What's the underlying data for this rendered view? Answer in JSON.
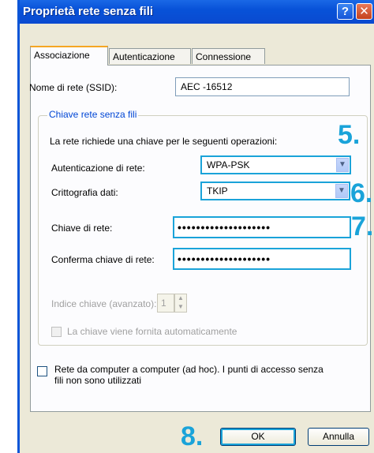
{
  "window": {
    "title": "Proprietà rete senza fili",
    "help_glyph": "?",
    "close_glyph": "✕"
  },
  "tabs": [
    {
      "label": "Associazione",
      "active": true
    },
    {
      "label": "Autenticazione",
      "active": false
    },
    {
      "label": "Connessione",
      "active": false
    }
  ],
  "ssid": {
    "label": "Nome di rete (SSID):",
    "value": "AEC -16512"
  },
  "wireless_key": {
    "legend": "Chiave rete senza fili",
    "intro": "La rete richiede una chiave per le seguenti operazioni:",
    "auth": {
      "label": "Autenticazione di rete:",
      "value": "WPA-PSK"
    },
    "encryption": {
      "label": "Crittografia dati:",
      "value": "TKIP"
    },
    "key": {
      "label": "Chiave di rete:",
      "value": "••••••••••••••••••••"
    },
    "confirm": {
      "label": "Conferma chiave di rete:",
      "value": "••••••••••••••••••••"
    },
    "index": {
      "label": "Indice chiave (avanzato):",
      "value": "1"
    },
    "auto": {
      "label": "La chiave viene fornita automaticamente"
    }
  },
  "adhoc": {
    "label": "Rete da computer a computer (ad hoc). I punti di accesso senza fili non sono utilizzati"
  },
  "buttons": {
    "ok": "OK",
    "cancel": "Annulla"
  },
  "steps": {
    "s5": "5.",
    "s6": "6.",
    "s7": "7.",
    "s8": "8."
  },
  "colors": {
    "accent": "#1aa3d9",
    "title_bar": "#0a55d8",
    "dialog_bg": "#ece9d8"
  }
}
